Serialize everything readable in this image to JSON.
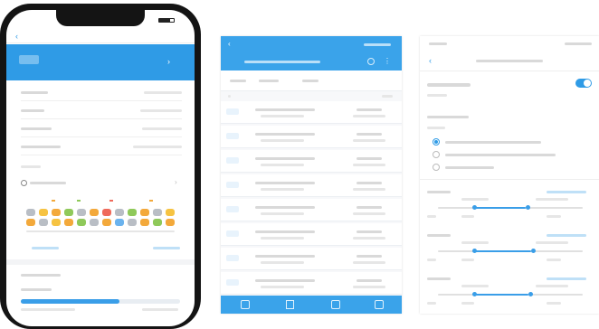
{
  "colors": {
    "primary_blue": "#2f9be6",
    "header_blue": "#3aa3ea",
    "seat_orange": "#f3a93b",
    "seat_green": "#8fc95a",
    "seat_gray": "#b9bec5",
    "seat_red": "#ef6a5b",
    "seat_yellow": "#f6c342",
    "seat_blue": "#6bb3ee",
    "progress_fill": "#3a9ee8"
  },
  "phone1": {
    "status_time": "",
    "app_title": "",
    "header_card": {
      "line1": "",
      "line2": "",
      "line3": ""
    },
    "details": [
      {
        "label": "",
        "value": ""
      },
      {
        "label": "",
        "value": ""
      },
      {
        "label": "",
        "value": ""
      },
      {
        "label": "",
        "value": ""
      }
    ],
    "section_label": "",
    "seat_legend": "",
    "seat_map_footer_left": "",
    "seat_map_footer_right": "",
    "bottom_label_1": "",
    "bottom_label_2": "",
    "progress": {
      "value": 0.62
    }
  },
  "phone2": {
    "title": "",
    "tabs": [
      "",
      "",
      ""
    ],
    "list": [
      {
        "col1": "",
        "col2": "",
        "col3": "",
        "col4": ""
      },
      {
        "col1": "",
        "col2": "",
        "col3": "",
        "col4": ""
      },
      {
        "col1": "",
        "col2": "",
        "col3": "",
        "col4": ""
      },
      {
        "col1": "",
        "col2": "",
        "col3": "",
        "col4": ""
      },
      {
        "col1": "",
        "col2": "",
        "col3": "",
        "col4": ""
      },
      {
        "col1": "",
        "col2": "",
        "col3": "",
        "col4": ""
      },
      {
        "col1": "",
        "col2": "",
        "col3": "",
        "col4": ""
      },
      {
        "col1": "",
        "col2": "",
        "col3": "",
        "col4": ""
      }
    ],
    "tabbar_icons": [
      "home-icon",
      "document-icon",
      "chart-icon",
      "settings-icon"
    ]
  },
  "phone3": {
    "status_time": "",
    "status_right": "",
    "title": "",
    "toggle_label": "",
    "toggle_sub": "",
    "toggle_on": true,
    "group_label": "",
    "group_sub": "",
    "options": [
      "",
      "",
      ""
    ],
    "selected_option_index": 0,
    "sliders": [
      {
        "label": "",
        "right": "",
        "level": 0.48
      },
      {
        "label": "",
        "right": "",
        "level": 0.52
      },
      {
        "label": "",
        "right": "",
        "level": 0.5
      }
    ]
  }
}
